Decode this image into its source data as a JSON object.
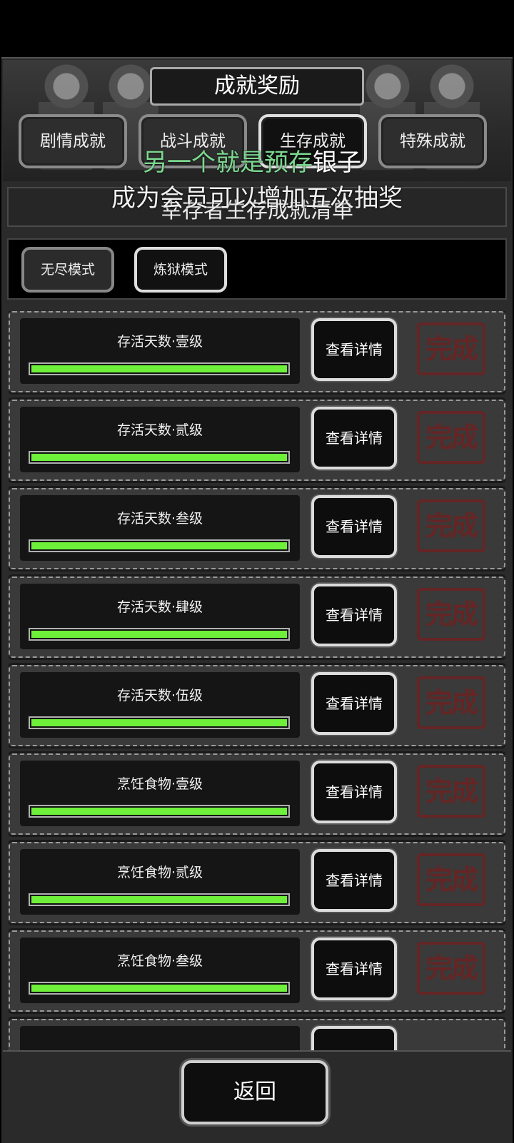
{
  "header": {
    "title": "成就奖励",
    "tabs": [
      {
        "label": "剧情成就",
        "active": false
      },
      {
        "label": "战斗成就",
        "active": false
      },
      {
        "label": "生存成就",
        "active": true
      },
      {
        "label": "特殊成就",
        "active": false
      }
    ]
  },
  "overlay": {
    "line1_green": "另一个就是预存",
    "line1_white": "银子",
    "line2": "成为会员可以增加五次抽奖"
  },
  "section": {
    "subtitle": "幸存者生存成就清单"
  },
  "modes": [
    {
      "label": "无尽模式",
      "active": false
    },
    {
      "label": "炼狱模式",
      "active": true
    }
  ],
  "achievements": [
    {
      "name": "存活天数·壹级",
      "progress": 1.0,
      "button": "查看详情",
      "stamp": "完成"
    },
    {
      "name": "存活天数·贰级",
      "progress": 1.0,
      "button": "查看详情",
      "stamp": "完成"
    },
    {
      "name": "存活天数·叁级",
      "progress": 1.0,
      "button": "查看详情",
      "stamp": "完成"
    },
    {
      "name": "存活天数·肆级",
      "progress": 1.0,
      "button": "查看详情",
      "stamp": "完成"
    },
    {
      "name": "存活天数·伍级",
      "progress": 1.0,
      "button": "查看详情",
      "stamp": "完成"
    },
    {
      "name": "烹饪食物·壹级",
      "progress": 1.0,
      "button": "查看详情",
      "stamp": "完成"
    },
    {
      "name": "烹饪食物·贰级",
      "progress": 1.0,
      "button": "查看详情",
      "stamp": "完成"
    },
    {
      "name": "烹饪食物·叁级",
      "progress": 1.0,
      "button": "查看详情",
      "stamp": "完成"
    }
  ],
  "footer": {
    "back_label": "返回"
  },
  "colors": {
    "progress_fill": "#6ef03a",
    "stamp": "#6a2323",
    "overlay_green": "#7bd88f"
  }
}
